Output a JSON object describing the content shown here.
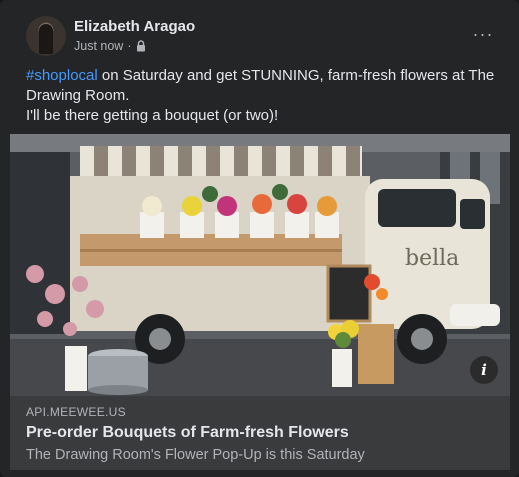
{
  "post": {
    "author": "Elizabeth Aragao",
    "timestamp": "Just now",
    "separator": "·",
    "audience_icon": "lock-icon",
    "more_icon": "more-options-icon",
    "more_label": "···",
    "hashtag": "#shoplocal",
    "line1_rest": " on Saturday and get STUNNING, farm-fresh flowers at The Drawing Room.",
    "line2": "I'll be there getting a bouquet (or two)!"
  },
  "image": {
    "brand_text": "bella",
    "info_icon": "info-icon",
    "info_label": "i"
  },
  "link_preview": {
    "domain": "API.MEEWEE.US",
    "title": "Pre-order Bouquets of Farm-fresh Flowers",
    "description": "The Drawing Room's Flower Pop-Up is this Saturday"
  },
  "colors": {
    "background": "#242526",
    "hashtag": "#4599ff",
    "link_panel": "#3a3b3c"
  }
}
